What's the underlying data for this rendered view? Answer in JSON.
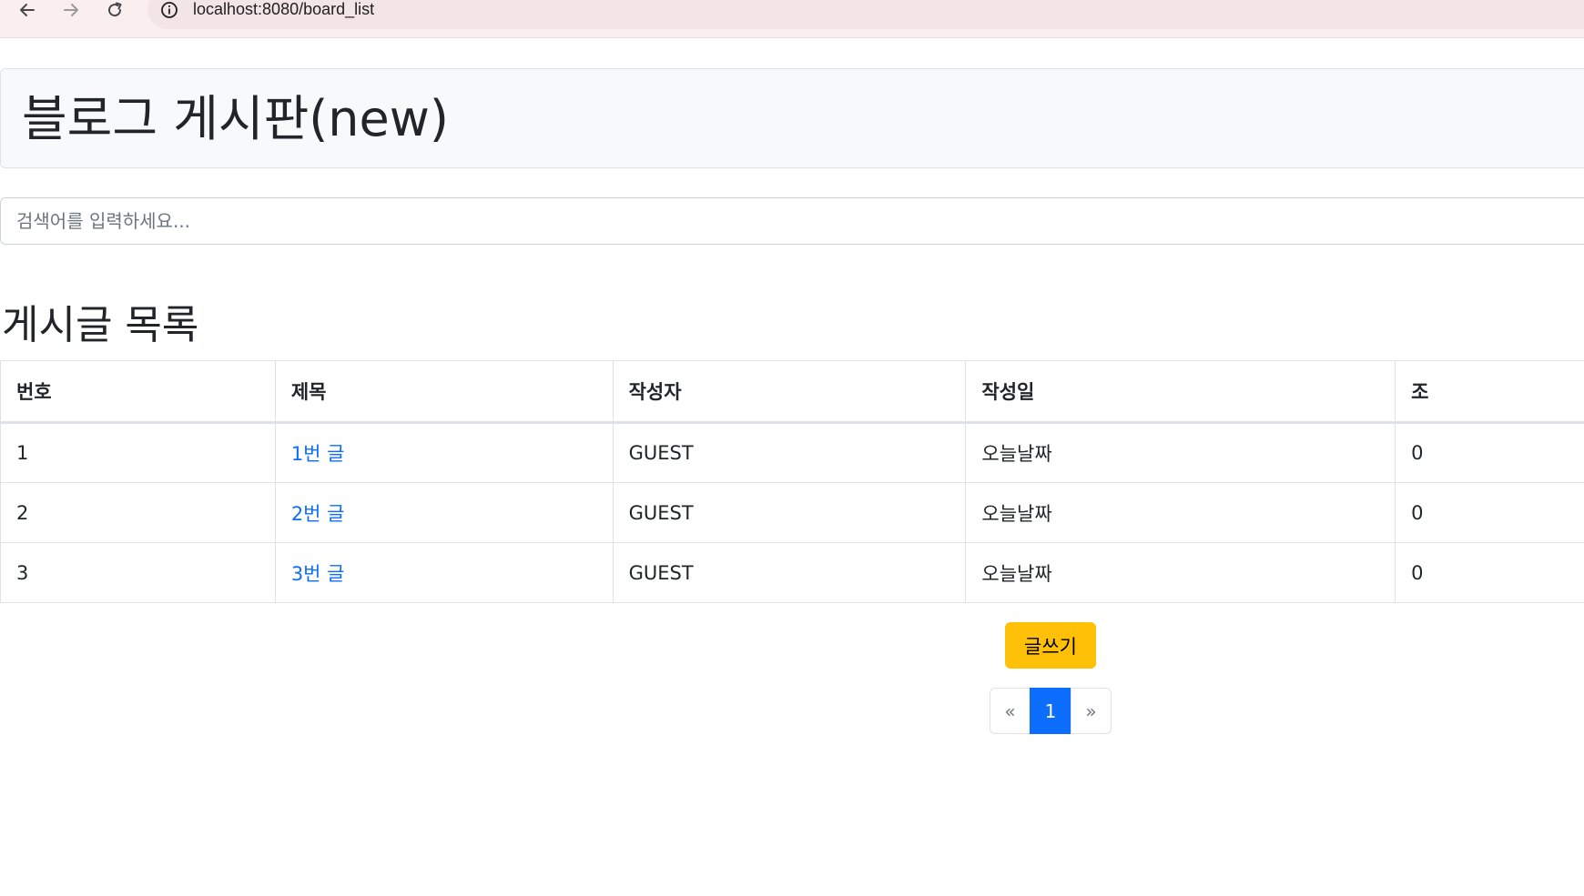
{
  "browser": {
    "url": "localhost:8080/board_list"
  },
  "page": {
    "title": "블로그 게시판(new)",
    "search_placeholder": "검색어를 입력하세요...",
    "section_title": "게시글 목록"
  },
  "table": {
    "headers": {
      "no": "번호",
      "title": "제목",
      "author": "작성자",
      "date": "작성일",
      "views": "조"
    },
    "rows": [
      {
        "no": "1",
        "title": "1번 글",
        "author": "GUEST",
        "date": "오늘날짜",
        "views": "0"
      },
      {
        "no": "2",
        "title": "2번 글",
        "author": "GUEST",
        "date": "오늘날짜",
        "views": "0"
      },
      {
        "no": "3",
        "title": "3번 글",
        "author": "GUEST",
        "date": "오늘날짜",
        "views": "0"
      }
    ]
  },
  "actions": {
    "write_label": "글쓰기"
  },
  "pagination": {
    "prev": "«",
    "current": "1",
    "next": "»"
  },
  "colors": {
    "link": "#0d6efd",
    "write_button": "#ffc107",
    "active_page": "#0d6efd",
    "toolbar": "#fbeeef"
  },
  "icons": [
    "back-arrow-icon",
    "forward-arrow-icon",
    "reload-icon",
    "site-info-icon"
  ]
}
